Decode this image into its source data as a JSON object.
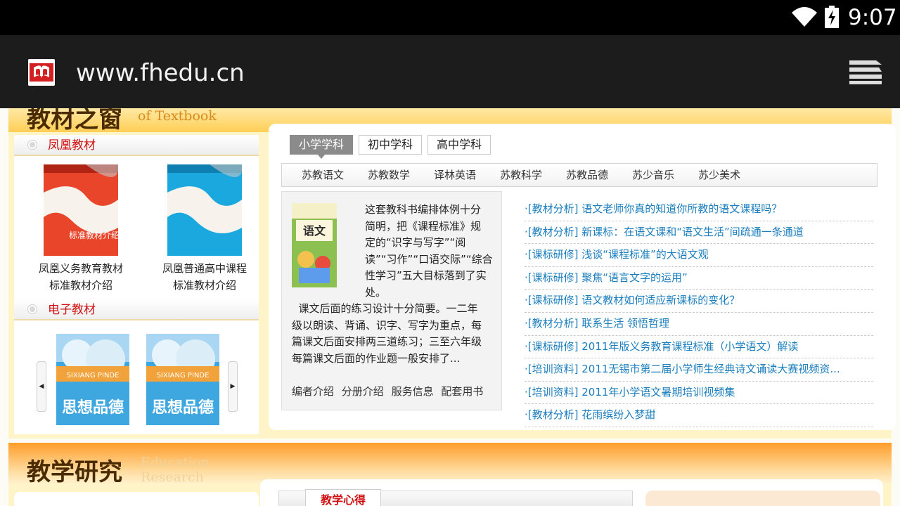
{
  "status_bar": {
    "time": "9:07",
    "wifi_icon": "wifi-icon",
    "battery_icon": "battery-charging-icon"
  },
  "browser": {
    "url": "www.fhedu.cn",
    "favicon_icon": "site-logo-icon",
    "menu_icon": "tabs-menu-icon"
  },
  "textbook_section": {
    "title_cn": "教材之窗",
    "title_en_line1": "...",
    "title_en_line2": "of Textbook",
    "fenghuang": {
      "label": "凤凰教材",
      "books": [
        {
          "label_line1": "凤凰义务教育教材",
          "label_line2": "标准教材介绍",
          "color": "#e8452b"
        },
        {
          "label_line1": "凤凰普通高中课程",
          "label_line2": "标准教材介绍",
          "color": "#1aa8df"
        }
      ]
    },
    "electronic": {
      "label": "电子教材",
      "books": [
        {
          "title": "思想品德",
          "subtitle": "SIXIANG PINDE"
        },
        {
          "title": "思想品德",
          "subtitle": "SIXIANG PINDE"
        }
      ]
    }
  },
  "level_tabs": [
    "小学学科",
    "初中学科",
    "高中学科"
  ],
  "subjects": [
    "苏教语文",
    "苏教数学",
    "译林英语",
    "苏教科学",
    "苏教品德",
    "苏少音乐",
    "苏少美术"
  ],
  "intro": {
    "cover_title": "语文",
    "text_lines": [
      "这套教科书编排体例十分",
      "简明，把《课程标准》规",
      "定的“识字与写字”“阅",
      "读”“习作”“口语交际”“综合",
      "性学习”五大目标落到了实",
      "处。"
    ],
    "text2_lines": [
      "  课文后面的练习设计十分简要。一二年",
      "级以朗读、背诵、识字、写字为重点，每",
      "篇课文后面安排两三道练习；三至六年级",
      "每篇课文后面的作业题一般安排了..."
    ],
    "links": [
      "编者介绍",
      "分册介绍",
      "服务信息",
      "配套用书"
    ]
  },
  "news": [
    "·[教材分析] 语文老师你真的知道你所教的语文课程吗？",
    "·[教材分析] 新课标：在语文课和“语文生活”间疏通一条通道",
    "·[课标研修] 浅谈“课程标准”的大语文观",
    "·[课标研修] 聚焦“语言文字的运用”",
    "·[课标研修] 语文教材如何适应新课标的变化？",
    "·[教材分析] 联系生活 领悟哲理",
    "·[课标研修] 2011年版义务教育课程标准（小学语文）解读",
    "·[培训资料] 2011无锡市第二届小学师生经典诗文诵读大赛视频资...",
    "·[培训资料] 2011年小学语文暑期培训视频集",
    "·[教材分析] 花雨缤纷入梦甜"
  ],
  "research_section": {
    "title_cn": "教学研究",
    "title_en_line1": "Education",
    "title_en_line2": "Research",
    "tab": "教学心得",
    "right_title": "..."
  }
}
